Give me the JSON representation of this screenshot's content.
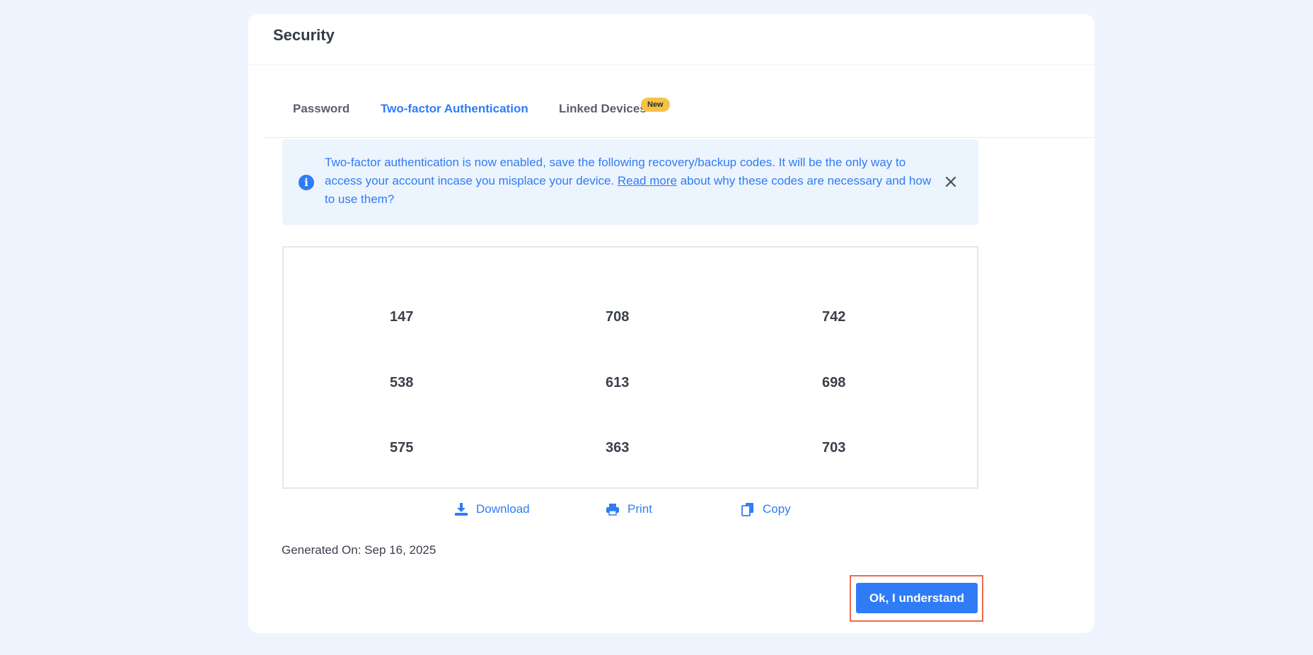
{
  "card": {
    "title": "Security"
  },
  "tabs": [
    {
      "label": "Password",
      "active": false
    },
    {
      "label": "Two-factor Authentication",
      "active": true
    },
    {
      "label": "Linked Devices",
      "active": false,
      "badge": "New"
    }
  ],
  "alert": {
    "text_before": "Two-factor authentication is now enabled, save the following recovery/backup codes. It will be the only way to access your account incase you misplace your device. ",
    "link_text": "Read more",
    "text_after": " about why these codes are necessary and how to use them?",
    "icon": "info-icon",
    "close_icon": "close-icon"
  },
  "codes": [
    [
      "147",
      "708",
      "742"
    ],
    [
      "538",
      "613",
      "698"
    ],
    [
      "575",
      "363",
      "703"
    ]
  ],
  "actions": {
    "download": {
      "label": "Download",
      "icon": "download-icon"
    },
    "print": {
      "label": "Print",
      "icon": "printer-icon"
    },
    "copy": {
      "label": "Copy",
      "icon": "copy-icon"
    }
  },
  "generated_on": "Generated On: Sep 16, 2025",
  "confirm_button": {
    "label": "Ok, I understand"
  },
  "colors": {
    "accent": "#2f7cf6",
    "background": "#eef5fe",
    "badge": "#f7c244",
    "highlight_border": "#ef6a4a"
  }
}
